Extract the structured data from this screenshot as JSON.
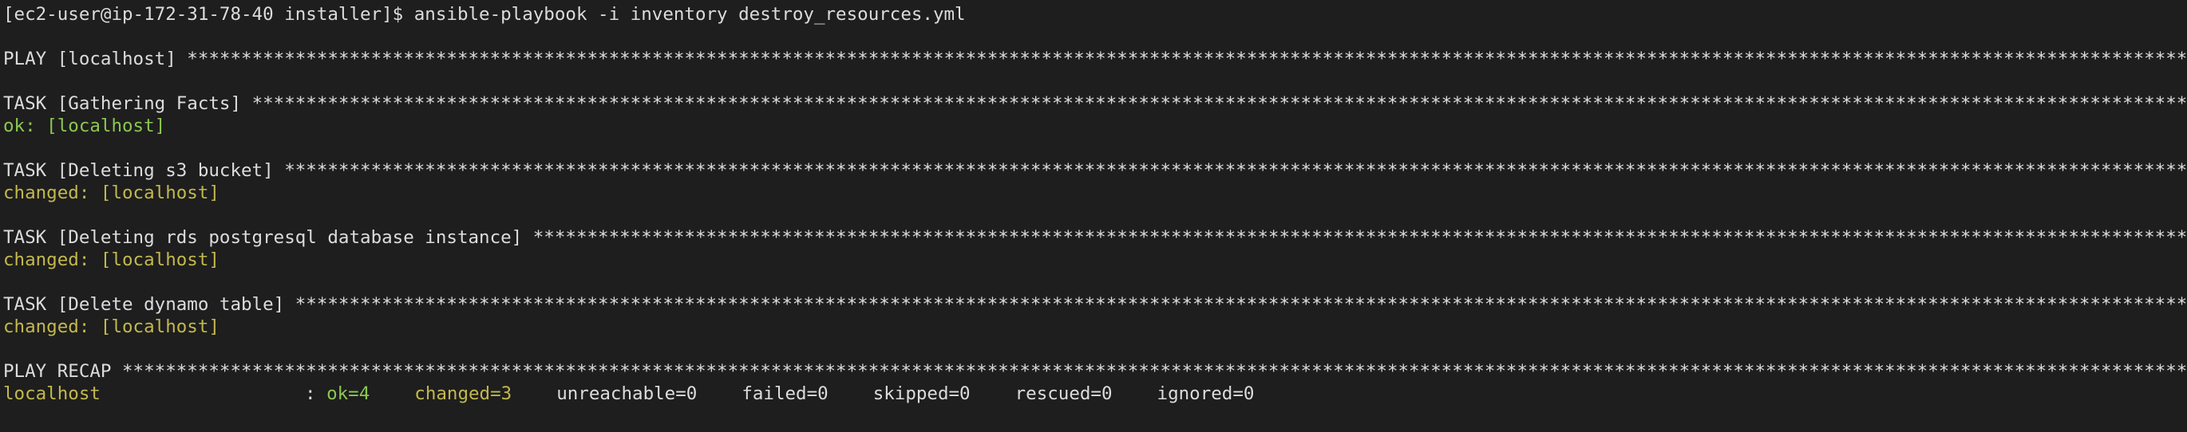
{
  "prompt": "[ec2-user@ip-172-31-78-40 installer]$ ansible-playbook -i inventory destroy_resources.yml",
  "stars": "****************************************************************************************************************************************************************************************************************************************************************************************************************************************************************************************************************",
  "play": {
    "header": "PLAY [localhost] "
  },
  "tasks": [
    {
      "header": "TASK [Gathering Facts] ",
      "result": "ok: [localhost]",
      "status": "ok"
    },
    {
      "header": "TASK [Deleting s3 bucket] ",
      "result": "changed: [localhost]",
      "status": "changed"
    },
    {
      "header": "TASK [Deleting rds postgresql database instance] ",
      "result": "changed: [localhost]",
      "status": "changed"
    },
    {
      "header": "TASK [Delete dynamo table] ",
      "result": "changed: [localhost]",
      "status": "changed"
    }
  ],
  "recap": {
    "header": "PLAY RECAP ",
    "host": "localhost",
    "separator": ": ",
    "ok": "ok=4",
    "changed": "changed=3",
    "unreachable": "unreachable=0",
    "failed": "failed=0",
    "skipped": "skipped=0",
    "rescued": "rescued=0",
    "ignored": "ignored=0"
  },
  "colors": {
    "background": "#1e1e1e",
    "text": "#dcdcdc",
    "ok": "#8cc751",
    "changed": "#c3b84d"
  }
}
